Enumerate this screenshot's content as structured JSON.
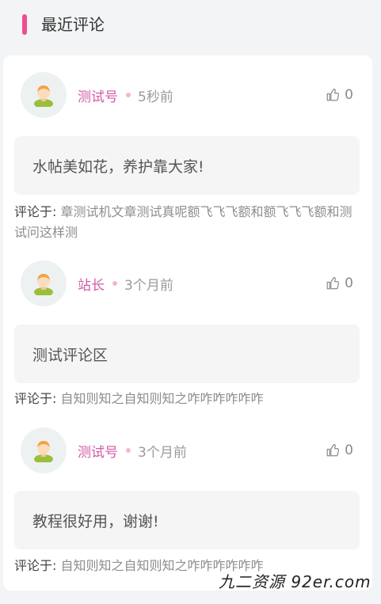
{
  "section": {
    "title": "最近评论"
  },
  "comments": [
    {
      "author": "测试号",
      "time": "5秒前",
      "likes": "0",
      "content": "水帖美如花，养护靠大家!",
      "reply_prefix": "评论于:",
      "reply_target": "章测试机文章测试真呢额飞飞飞额和额飞飞飞额和测试问这样测"
    },
    {
      "author": "站长",
      "time": "3个月前",
      "likes": "0",
      "content": "测试评论区",
      "reply_prefix": "评论于:",
      "reply_target": "自知则知之自知则知之咋咋咋咋咋咋"
    },
    {
      "author": "测试号",
      "time": "3个月前",
      "likes": "0",
      "content": "教程很好用，谢谢!",
      "reply_prefix": "评论于:",
      "reply_target": "自知则知之自知则知之咋咋咋咋咋咋"
    }
  ],
  "watermark": "九二资源 92er.com",
  "colors": {
    "accent": "#ec4f92",
    "author": "#d45aa6",
    "muted": "#9a9a9a"
  }
}
